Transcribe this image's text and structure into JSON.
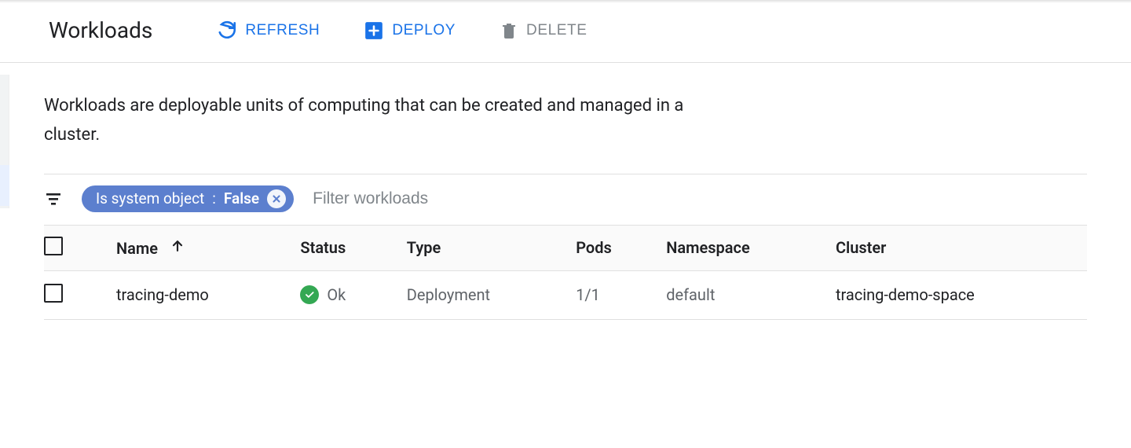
{
  "header": {
    "title": "Workloads",
    "actions": {
      "refresh": "REFRESH",
      "deploy": "DEPLOY",
      "delete": "DELETE"
    }
  },
  "description": "Workloads are deployable units of computing that can be created and managed in a cluster.",
  "filter": {
    "chip_key": "Is system object",
    "chip_value": "False",
    "placeholder": "Filter workloads"
  },
  "table": {
    "columns": {
      "name": "Name",
      "status": "Status",
      "type": "Type",
      "pods": "Pods",
      "namespace": "Namespace",
      "cluster": "Cluster"
    },
    "rows": [
      {
        "name": "tracing-demo",
        "status": "Ok",
        "type": "Deployment",
        "pods": "1/1",
        "namespace": "default",
        "cluster": "tracing-demo-space"
      }
    ]
  }
}
